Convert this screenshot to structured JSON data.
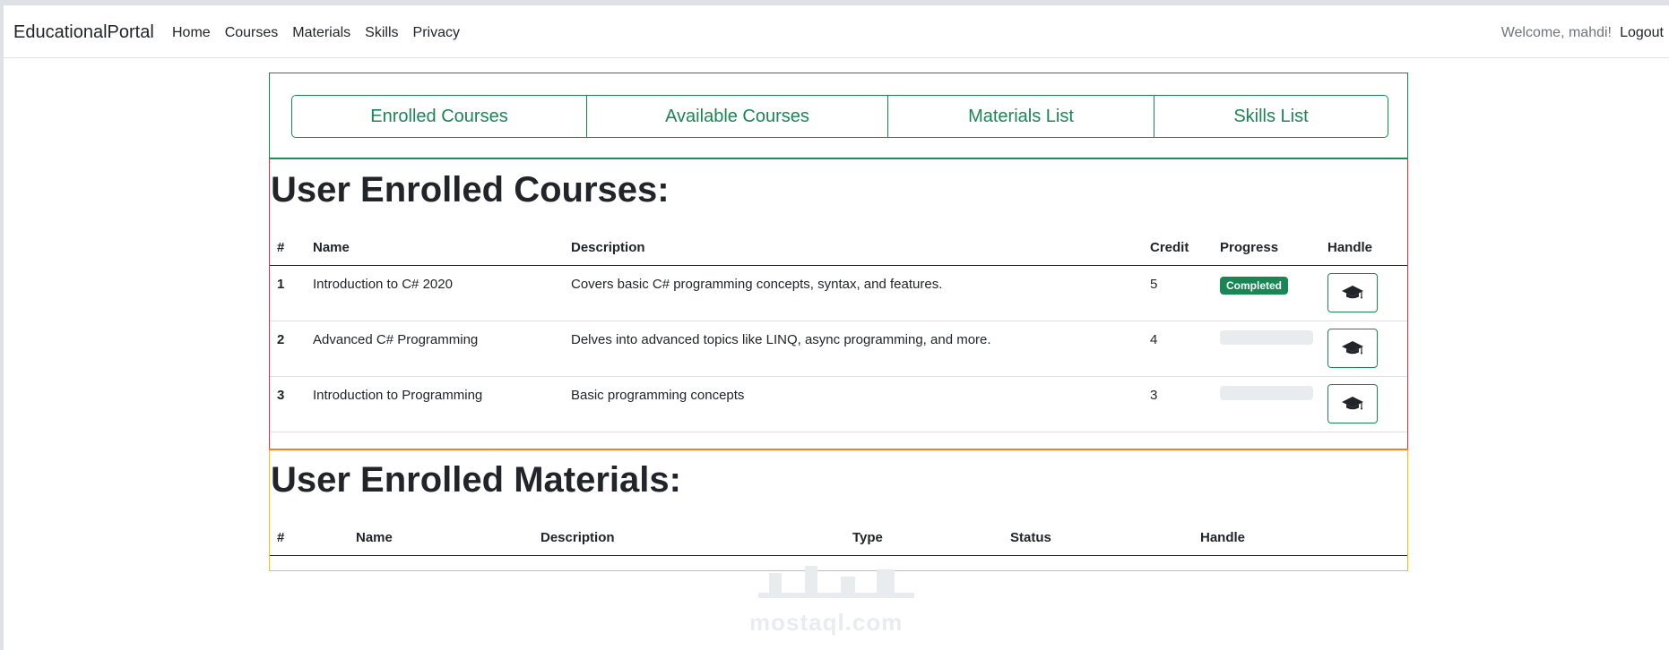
{
  "navbar": {
    "brand": "EducationalPortal",
    "links": [
      "Home",
      "Courses",
      "Materials",
      "Skills",
      "Privacy"
    ],
    "welcome": "Welcome, mahdi!",
    "logout": "Logout"
  },
  "tabs": [
    "Enrolled Courses",
    "Available Courses",
    "Materials List",
    "Skills List"
  ],
  "courses": {
    "title": "User Enrolled Courses:",
    "headers": [
      "#",
      "Name",
      "Description",
      "Credit",
      "Progress",
      "Handle"
    ],
    "rows": [
      {
        "num": "1",
        "name": "Introduction to C# 2020",
        "description": "Covers basic C# programming concepts, syntax, and features.",
        "credit": "5",
        "progress": "Completed",
        "progress_fraction": 1
      },
      {
        "num": "2",
        "name": "Advanced C# Programming",
        "description": "Delves into advanced topics like LINQ, async programming, and more.",
        "credit": "4",
        "progress": "",
        "progress_fraction": 0
      },
      {
        "num": "3",
        "name": "Introduction to Programming",
        "description": "Basic programming concepts",
        "credit": "3",
        "progress": "",
        "progress_fraction": 0
      }
    ]
  },
  "materials": {
    "title": "User Enrolled Materials:",
    "headers": [
      "#",
      "Name",
      "Description",
      "Type",
      "Status",
      "Handle"
    ]
  },
  "watermark": "mostaql.com",
  "colors": {
    "accent": "#198754",
    "danger": "#dc3545",
    "warning": "#ffc107",
    "orange": "#fd7e14"
  },
  "icons": {
    "handle": "graduation-cap-icon"
  }
}
